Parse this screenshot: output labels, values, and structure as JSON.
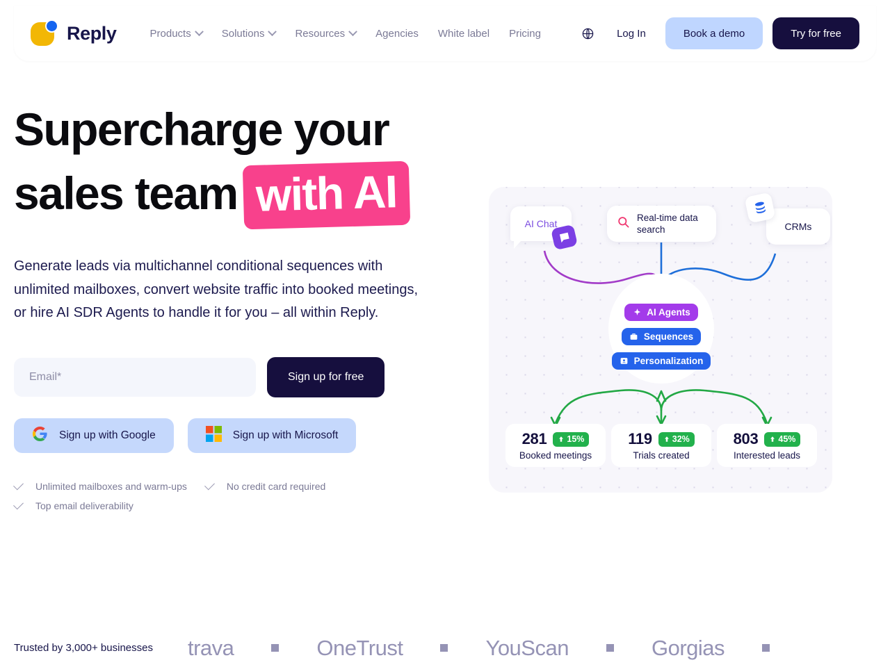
{
  "brand": {
    "name": "Reply",
    "logo_icon": "reply-logo-mark"
  },
  "nav": {
    "items": [
      {
        "label": "Products",
        "has_caret": true
      },
      {
        "label": "Solutions",
        "has_caret": true
      },
      {
        "label": "Resources",
        "has_caret": true
      },
      {
        "label": "Agencies",
        "has_caret": false
      },
      {
        "label": "White label",
        "has_caret": false
      },
      {
        "label": "Pricing",
        "has_caret": false
      }
    ],
    "globe_icon": "globe-icon",
    "login_label": "Log In",
    "demo_label": "Book a demo",
    "free_label": "Try for free",
    "demo_color": "#BFD6FF",
    "free_color": "#160F3E"
  },
  "hero": {
    "headline_line1": "Supercharge your",
    "headline_line2": "sales team",
    "headline_highlight": "with AI",
    "highlight_color": "#F8418C",
    "subhead": "Generate leads via multichannel conditional sequences with unlimited mailboxes, convert website traffic into booked meetings, or hire AI SDR Agents to handle it for you – all within Reply.",
    "email_placeholder": "Email*",
    "email_value": "",
    "signup_label": "Sign up for free",
    "sso": [
      {
        "label": "Sign up with Google",
        "icon": "google-icon"
      },
      {
        "label": "Sign up with Microsoft",
        "icon": "microsoft-icon"
      }
    ],
    "checks": [
      "Unlimited mailboxes and warm-ups",
      "No credit card required",
      "Top email deliverability"
    ]
  },
  "illustration": {
    "sources": [
      {
        "label": "AI Chat",
        "icon": "chat-star-icon",
        "color": "#7C4DE0"
      },
      {
        "label": "Real-time data search",
        "icon": "search-icon",
        "color": "#17154A"
      },
      {
        "label": "CRMs",
        "icon": "database-icon",
        "color": "#17154A"
      }
    ],
    "pills": [
      {
        "label": "AI Agents",
        "icon": "sparkle-icon",
        "color": "#A33BEA"
      },
      {
        "label": "Sequences",
        "icon": "briefcase-icon",
        "color": "#2563EB"
      },
      {
        "label": "Personalization",
        "icon": "contact-card-icon",
        "color": "#2563EB"
      }
    ],
    "stats": [
      {
        "value": "281",
        "delta": "15%",
        "label": "Booked meetings"
      },
      {
        "value": "119",
        "delta": "32%",
        "label": "Trials created"
      },
      {
        "value": "803",
        "delta": "45%",
        "label": "Interested leads"
      }
    ],
    "badge_color": "#22B14C"
  },
  "trusted": {
    "label": "Trusted by 3,000+ businesses",
    "logos": [
      "trava",
      "OneTrust",
      "YouScan",
      "Gorgias"
    ]
  }
}
